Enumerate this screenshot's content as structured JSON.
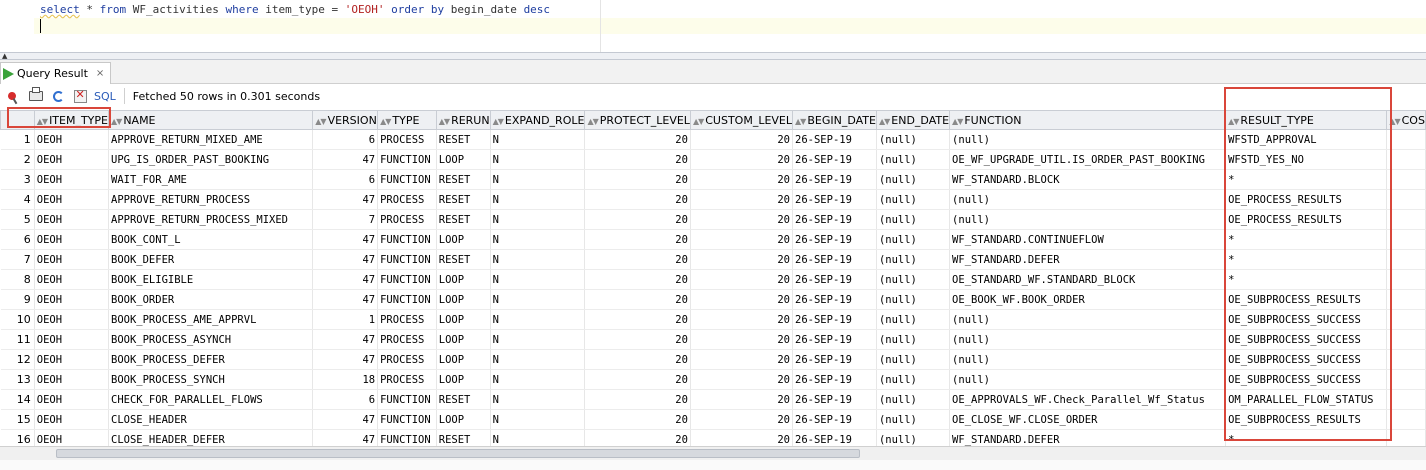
{
  "editor": {
    "sql": {
      "kw_select": "select",
      "star": "*",
      "kw_from": "from",
      "table": "WF_activities",
      "kw_where": "where",
      "column": "item_type",
      "eq": "=",
      "literal": "'OEOH'",
      "kw_order": "order",
      "kw_by": "by",
      "order_col": "begin_date",
      "kw_desc": "desc"
    }
  },
  "tab": {
    "label": "Query Result",
    "icon": "run-icon",
    "close": "×"
  },
  "toolbar": {
    "icons": [
      "pin-icon",
      "print-icon",
      "refresh-icon",
      "delete-icon"
    ],
    "sql_label": "SQL",
    "status": "Fetched 50 rows in 0.301 seconds"
  },
  "grid": {
    "sort_glyph": "▲▼",
    "columns": [
      "ITEM_TYPE",
      "NAME",
      "VERSION",
      "TYPE",
      "RERUN",
      "EXPAND_ROLE",
      "PROTECT_LEVEL",
      "CUSTOM_LEVEL",
      "BEGIN_DATE",
      "END_DATE",
      "FUNCTION",
      "RESULT_TYPE",
      "COS"
    ],
    "rows": [
      {
        "n": "1",
        "item_type": "OEOH",
        "name": "APPROVE_RETURN_MIXED_AME",
        "version": "6",
        "type": "PROCESS",
        "rerun": "RESET",
        "expand_role": "N",
        "protect_level": "20",
        "custom_level": "20",
        "begin_date": "26-SEP-19",
        "end_date": "(null)",
        "function": "(null)",
        "result_type": "WFSTD_APPROVAL"
      },
      {
        "n": "2",
        "item_type": "OEOH",
        "name": "UPG_IS_ORDER_PAST_BOOKING",
        "version": "47",
        "type": "FUNCTION",
        "rerun": "LOOP",
        "expand_role": "N",
        "protect_level": "20",
        "custom_level": "20",
        "begin_date": "26-SEP-19",
        "end_date": "(null)",
        "function": "OE_WF_UPGRADE_UTIL.IS_ORDER_PAST_BOOKING",
        "result_type": "WFSTD_YES_NO"
      },
      {
        "n": "3",
        "item_type": "OEOH",
        "name": "WAIT_FOR_AME",
        "version": "6",
        "type": "FUNCTION",
        "rerun": "RESET",
        "expand_role": "N",
        "protect_level": "20",
        "custom_level": "20",
        "begin_date": "26-SEP-19",
        "end_date": "(null)",
        "function": "WF_STANDARD.BLOCK",
        "result_type": "*"
      },
      {
        "n": "4",
        "item_type": "OEOH",
        "name": "APPROVE_RETURN_PROCESS",
        "version": "47",
        "type": "PROCESS",
        "rerun": "RESET",
        "expand_role": "N",
        "protect_level": "20",
        "custom_level": "20",
        "begin_date": "26-SEP-19",
        "end_date": "(null)",
        "function": "(null)",
        "result_type": "OE_PROCESS_RESULTS"
      },
      {
        "n": "5",
        "item_type": "OEOH",
        "name": "APPROVE_RETURN_PROCESS_MIXED",
        "version": "7",
        "type": "PROCESS",
        "rerun": "RESET",
        "expand_role": "N",
        "protect_level": "20",
        "custom_level": "20",
        "begin_date": "26-SEP-19",
        "end_date": "(null)",
        "function": "(null)",
        "result_type": "OE_PROCESS_RESULTS"
      },
      {
        "n": "6",
        "item_type": "OEOH",
        "name": "BOOK_CONT_L",
        "version": "47",
        "type": "FUNCTION",
        "rerun": "LOOP",
        "expand_role": "N",
        "protect_level": "20",
        "custom_level": "20",
        "begin_date": "26-SEP-19",
        "end_date": "(null)",
        "function": "WF_STANDARD.CONTINUEFLOW",
        "result_type": "*"
      },
      {
        "n": "7",
        "item_type": "OEOH",
        "name": "BOOK_DEFER",
        "version": "47",
        "type": "FUNCTION",
        "rerun": "RESET",
        "expand_role": "N",
        "protect_level": "20",
        "custom_level": "20",
        "begin_date": "26-SEP-19",
        "end_date": "(null)",
        "function": "WF_STANDARD.DEFER",
        "result_type": "*"
      },
      {
        "n": "8",
        "item_type": "OEOH",
        "name": "BOOK_ELIGIBLE",
        "version": "47",
        "type": "FUNCTION",
        "rerun": "LOOP",
        "expand_role": "N",
        "protect_level": "20",
        "custom_level": "20",
        "begin_date": "26-SEP-19",
        "end_date": "(null)",
        "function": "OE_STANDARD_WF.STANDARD_BLOCK",
        "result_type": "*"
      },
      {
        "n": "9",
        "item_type": "OEOH",
        "name": "BOOK_ORDER",
        "version": "47",
        "type": "FUNCTION",
        "rerun": "LOOP",
        "expand_role": "N",
        "protect_level": "20",
        "custom_level": "20",
        "begin_date": "26-SEP-19",
        "end_date": "(null)",
        "function": "OE_BOOK_WF.BOOK_ORDER",
        "result_type": "OE_SUBPROCESS_RESULTS"
      },
      {
        "n": "10",
        "item_type": "OEOH",
        "name": "BOOK_PROCESS_AME_APPRVL",
        "version": "1",
        "type": "PROCESS",
        "rerun": "LOOP",
        "expand_role": "N",
        "protect_level": "20",
        "custom_level": "20",
        "begin_date": "26-SEP-19",
        "end_date": "(null)",
        "function": "(null)",
        "result_type": "OE_SUBPROCESS_SUCCESS"
      },
      {
        "n": "11",
        "item_type": "OEOH",
        "name": "BOOK_PROCESS_ASYNCH",
        "version": "47",
        "type": "PROCESS",
        "rerun": "LOOP",
        "expand_role": "N",
        "protect_level": "20",
        "custom_level": "20",
        "begin_date": "26-SEP-19",
        "end_date": "(null)",
        "function": "(null)",
        "result_type": "OE_SUBPROCESS_SUCCESS"
      },
      {
        "n": "12",
        "item_type": "OEOH",
        "name": "BOOK_PROCESS_DEFER",
        "version": "47",
        "type": "PROCESS",
        "rerun": "LOOP",
        "expand_role": "N",
        "protect_level": "20",
        "custom_level": "20",
        "begin_date": "26-SEP-19",
        "end_date": "(null)",
        "function": "(null)",
        "result_type": "OE_SUBPROCESS_SUCCESS"
      },
      {
        "n": "13",
        "item_type": "OEOH",
        "name": "BOOK_PROCESS_SYNCH",
        "version": "18",
        "type": "PROCESS",
        "rerun": "LOOP",
        "expand_role": "N",
        "protect_level": "20",
        "custom_level": "20",
        "begin_date": "26-SEP-19",
        "end_date": "(null)",
        "function": "(null)",
        "result_type": "OE_SUBPROCESS_SUCCESS"
      },
      {
        "n": "14",
        "item_type": "OEOH",
        "name": "CHECK_FOR_PARALLEL_FLOWS",
        "version": "6",
        "type": "FUNCTION",
        "rerun": "RESET",
        "expand_role": "N",
        "protect_level": "20",
        "custom_level": "20",
        "begin_date": "26-SEP-19",
        "end_date": "(null)",
        "function": "OE_APPROVALS_WF.Check_Parallel_Wf_Status",
        "result_type": "OM_PARALLEL_FLOW_STATUS"
      },
      {
        "n": "15",
        "item_type": "OEOH",
        "name": "CLOSE_HEADER",
        "version": "47",
        "type": "FUNCTION",
        "rerun": "LOOP",
        "expand_role": "N",
        "protect_level": "20",
        "custom_level": "20",
        "begin_date": "26-SEP-19",
        "end_date": "(null)",
        "function": "OE_CLOSE_WF.CLOSE_ORDER",
        "result_type": "OE_SUBPROCESS_RESULTS"
      },
      {
        "n": "16",
        "item_type": "OEOH",
        "name": "CLOSE_HEADER_DEFER",
        "version": "47",
        "type": "FUNCTION",
        "rerun": "RESET",
        "expand_role": "N",
        "protect_level": "20",
        "custom_level": "20",
        "begin_date": "26-SEP-19",
        "end_date": "(null)",
        "function": "WF_STANDARD.DEFER",
        "result_type": "*"
      }
    ]
  },
  "colors": {
    "highlight": "#d9463a",
    "keyword": "#1f3ea0",
    "string": "#b22222",
    "link": "#2a5bb8",
    "run": "#3aa23a"
  }
}
